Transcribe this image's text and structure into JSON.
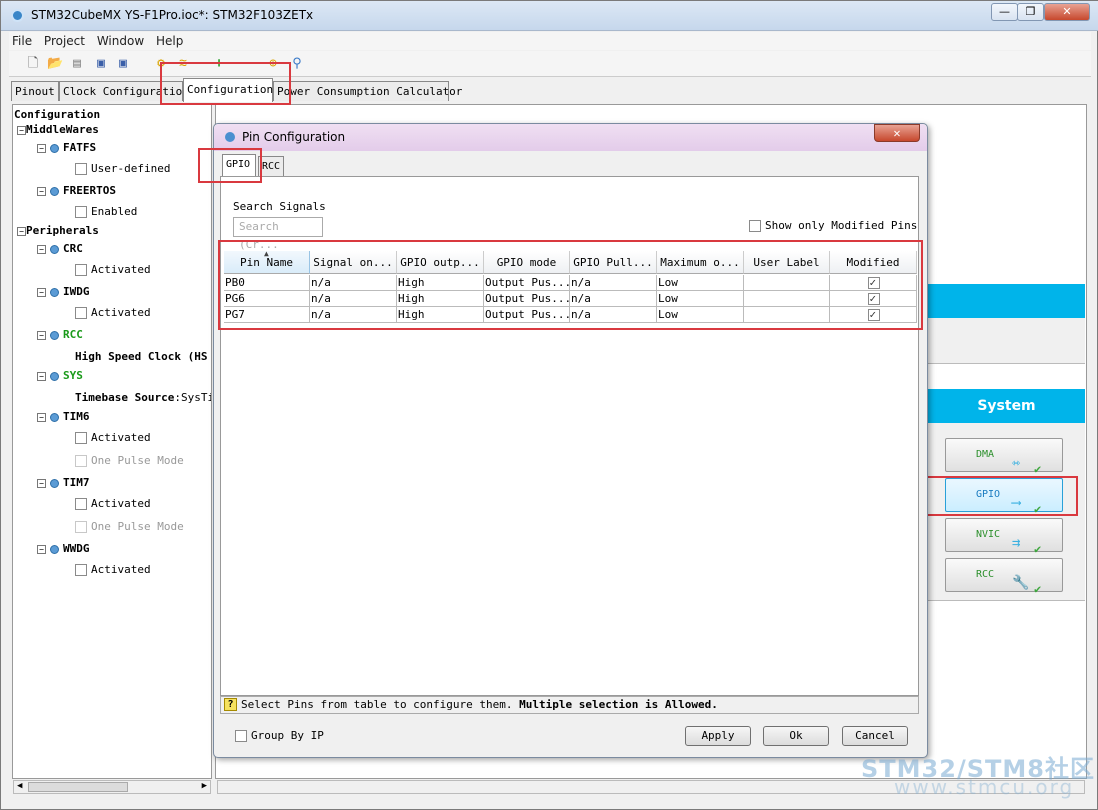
{
  "window": {
    "title": "STM32CubeMX YS-F1Pro.ioc*: STM32F103ZETx",
    "minimize": "—",
    "restore": "❐",
    "close": "✕"
  },
  "menu": [
    "File",
    "Project",
    "Window",
    "Help"
  ],
  "main_tabs": [
    "Pinout",
    "Clock Configuration",
    "Configuration",
    "Power Consumption Calculator"
  ],
  "tree": {
    "root": "Configuration",
    "middlewares": "MiddleWares",
    "fatfs": "FATFS",
    "fatfs_opt": "User-defined",
    "freertos": "FREERTOS",
    "freertos_opt": "Enabled",
    "peripherals": "Peripherals",
    "crc": "CRC",
    "crc_opt": "Activated",
    "iwdg": "IWDG",
    "iwdg_opt": "Activated",
    "rcc": "RCC",
    "rcc_opt": "High Speed Clock (HS",
    "sys": "SYS",
    "sys_opt_bold": "Timebase Source",
    "sys_opt_val": ":SysTi",
    "tim6": "TIM6",
    "tim6_opt1": "Activated",
    "tim6_opt2": "One Pulse Mode",
    "tim7": "TIM7",
    "tim7_opt1": "Activated",
    "tim7_opt2": "One Pulse Mode",
    "wwdg": "WWDG",
    "wwdg_opt": "Activated"
  },
  "system_panel": {
    "header": "System",
    "buttons": [
      "DMA",
      "GPIO",
      "NVIC",
      "RCC"
    ]
  },
  "dialog": {
    "title": "Pin Configuration",
    "close": "✕",
    "tabs": [
      "GPIO",
      "RCC"
    ],
    "search_label": "Search Signals",
    "search_placeholder": "Search (Cr...",
    "show_modified_label": "Show only Modified Pins",
    "columns": [
      "Pin Name",
      "Signal on...",
      "GPIO outp...",
      "GPIO mode",
      "GPIO Pull...",
      "Maximum o...",
      "User Label",
      "Modified"
    ],
    "rows": [
      {
        "pin": "PB0",
        "signal": "n/a",
        "output": "High",
        "mode": "Output Pus...",
        "pull": "n/a",
        "max": "Low",
        "label": "",
        "modified": true
      },
      {
        "pin": "PG6",
        "signal": "n/a",
        "output": "High",
        "mode": "Output Pus...",
        "pull": "n/a",
        "max": "Low",
        "label": "",
        "modified": true
      },
      {
        "pin": "PG7",
        "signal": "n/a",
        "output": "High",
        "mode": "Output Pus...",
        "pull": "n/a",
        "max": "Low",
        "label": "",
        "modified": true
      }
    ],
    "status_normal": "Select Pins from table to configure them.",
    "status_bold": "Multiple selection is Allowed.",
    "group_by_ip": "Group By IP",
    "apply": "Apply",
    "ok": "Ok",
    "cancel": "Cancel"
  },
  "watermark": {
    "line1": "STM32/STM8社区",
    "line2": "www.stmcu.org"
  },
  "colors": {
    "accent_cyan": "#00b4ea",
    "highlight_red": "#d9393f",
    "green_label": "#1a9a1a"
  }
}
